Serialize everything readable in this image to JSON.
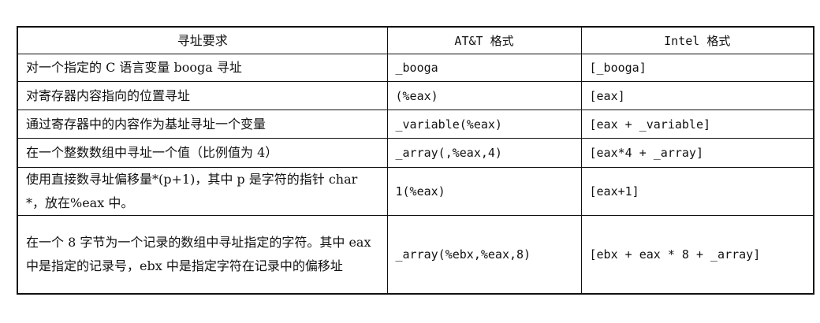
{
  "table": {
    "headers": [
      "寻址要求",
      "AT&T 格式",
      "Intel 格式"
    ],
    "rows": [
      [
        "对一个指定的 C 语言变量 booga 寻址",
        "_booga",
        "[_booga]"
      ],
      [
        "对寄存器内容指向的位置寻址",
        "(%eax)",
        "[eax]"
      ],
      [
        "通过寄存器中的内容作为基址寻址一个变量",
        "_variable(%eax)",
        "[eax + _variable]"
      ],
      [
        "在一个整数数组中寻址一个值（比例值为 4）",
        "_array(,%eax,4)",
        "[eax*4 + _array]"
      ],
      [
        "使用直接数寻址偏移量*(p+1)，其中 p 是字符的指针 char *，放在%eax 中。",
        "1(%eax)",
        "[eax+1]"
      ],
      [
        "在一个 8 字节为一个记录的数组中寻址指定的字符。其中 eax 中是指定的记录号，ebx 中是指定字符在记录中的偏移址",
        "_array(%ebx,%eax,8)",
        "[ebx + eax * 8 + _array]"
      ]
    ]
  }
}
